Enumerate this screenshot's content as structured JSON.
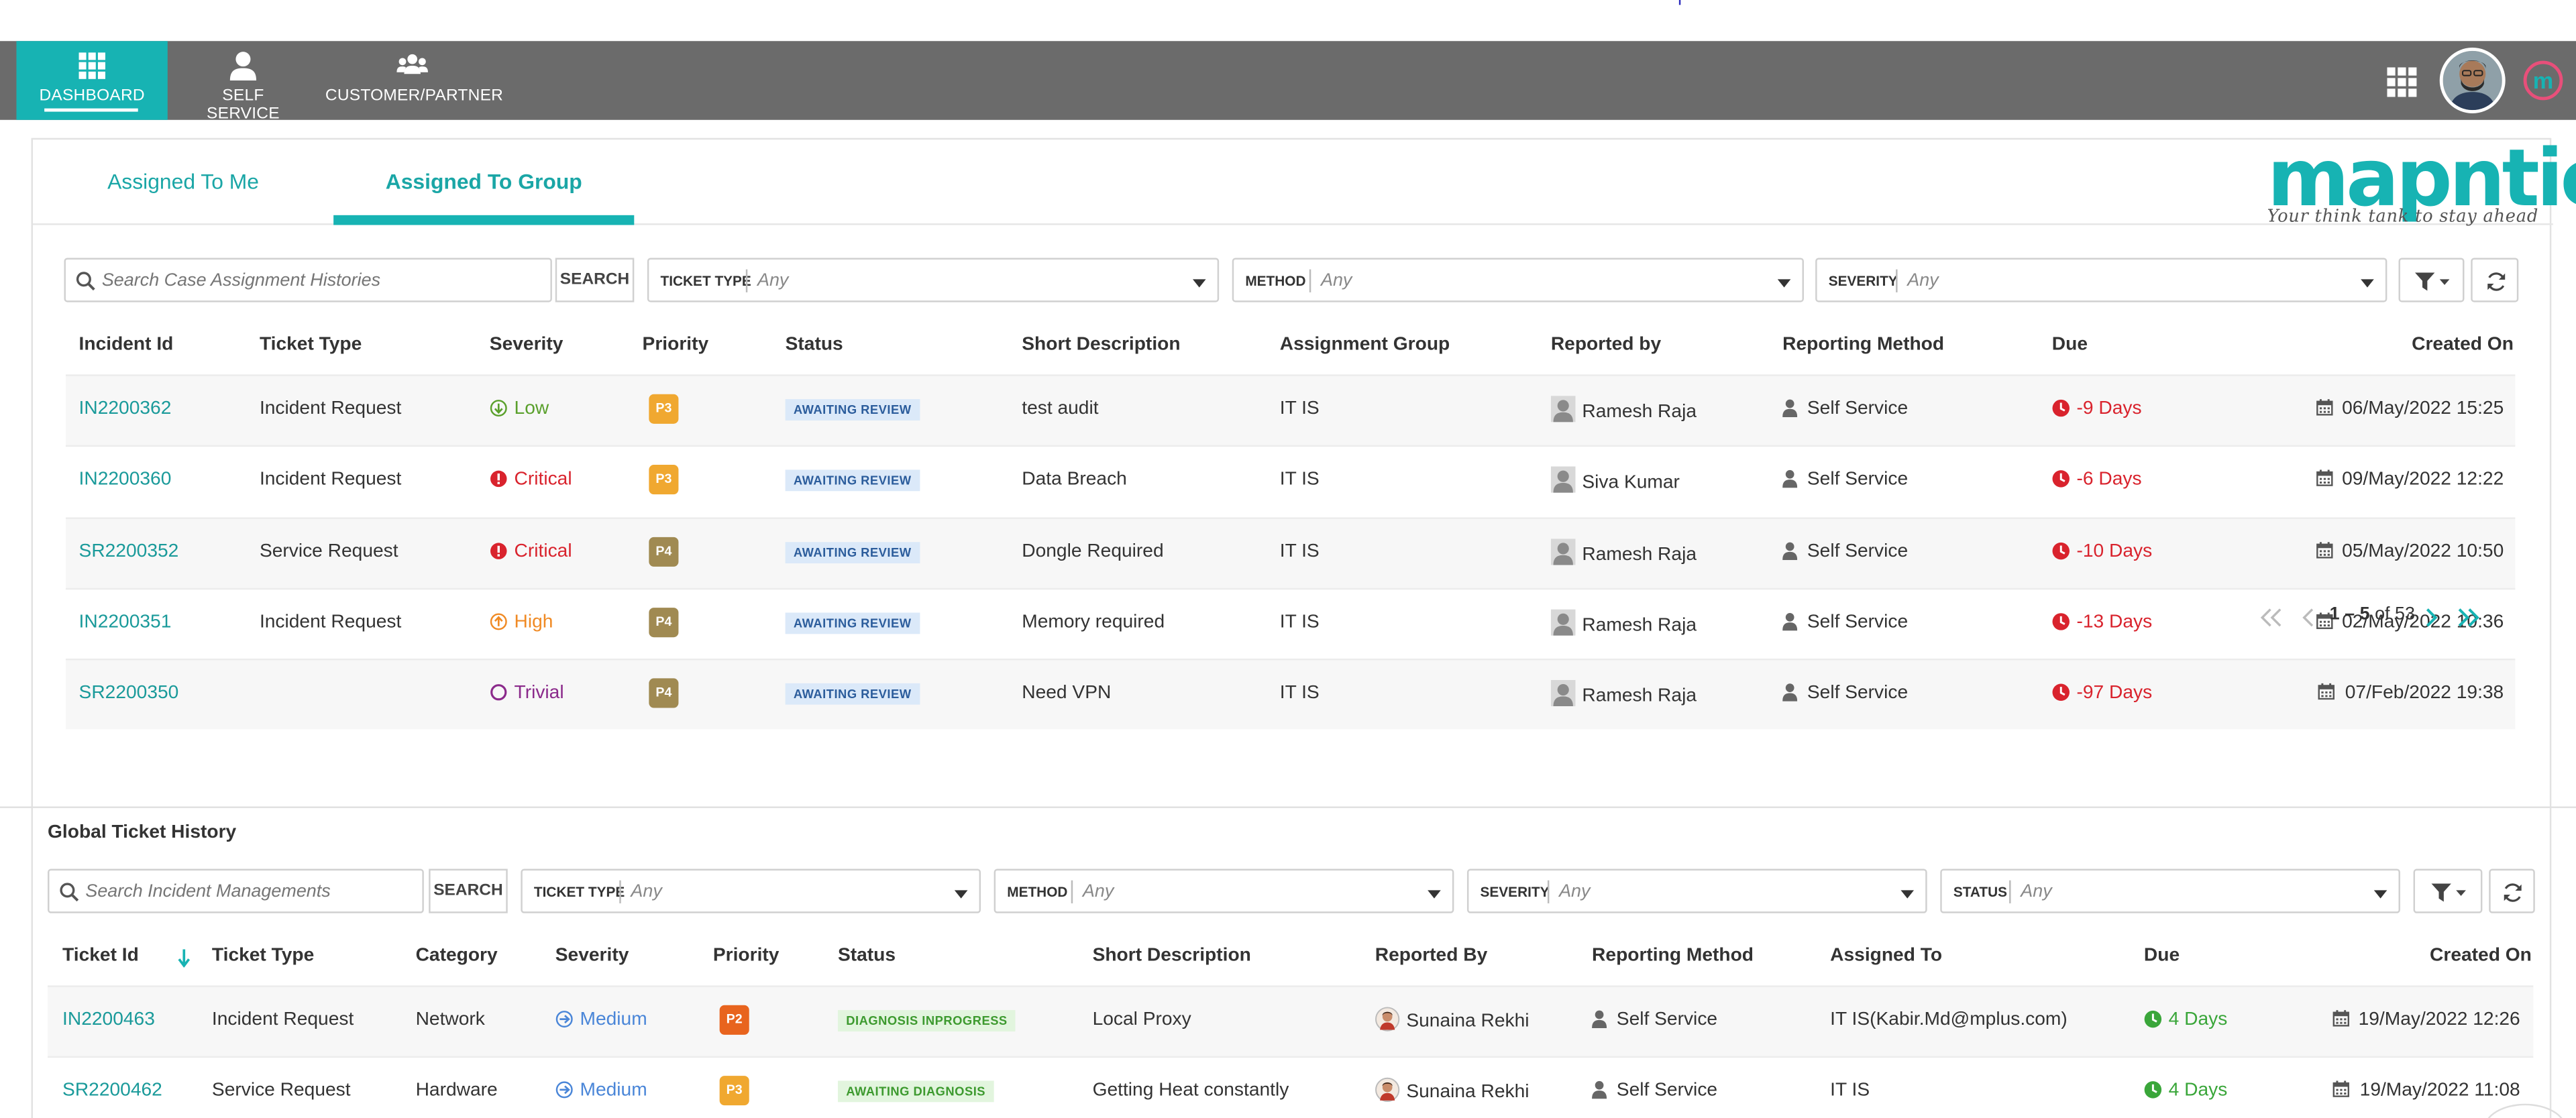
{
  "nav": {
    "items": [
      {
        "label": "DASHBOARD"
      },
      {
        "label": "SELF SERVICE"
      },
      {
        "label": "CUSTOMER/PARTNER"
      }
    ]
  },
  "tabs": [
    {
      "label": "Assigned To Me"
    },
    {
      "label": "Assigned To Group"
    }
  ],
  "brand": {
    "logo_text": "mapntic",
    "tagline": "Your think tank to stay ahead",
    "accent": "#17b3b3"
  },
  "group_filters": {
    "search_placeholder": "Search Case Assignment Histories",
    "search_label": "SEARCH",
    "ticket_type_label": "TICKET TYPE",
    "ticket_type_value": "Any",
    "method_label": "METHOD",
    "method_value": "Any",
    "severity_label": "SEVERITY",
    "severity_value": "Any"
  },
  "group_table": {
    "headers": [
      "Incident Id",
      "Ticket Type",
      "Severity",
      "Priority",
      "Status",
      "Short Description",
      "Assignment Group",
      "Reported by",
      "Reporting Method",
      "Due",
      "Created On"
    ],
    "rows": [
      {
        "id": "IN2200362",
        "type": "Incident Request",
        "severity": "Low",
        "sev_color": "#5aa02c",
        "priority": "P3",
        "prio_color": "#f0a830",
        "status": "AWAITING REVIEW",
        "desc": "test audit",
        "group": "IT IS",
        "reporter": "Ramesh Raja",
        "method": "Self Service",
        "due": "-9 Days",
        "created": "06/May/2022 15:25"
      },
      {
        "id": "IN2200360",
        "type": "Incident Request",
        "severity": "Critical",
        "sev_color": "#d9232d",
        "priority": "P3",
        "prio_color": "#f0a830",
        "status": "AWAITING REVIEW",
        "desc": "Data Breach",
        "group": "IT IS",
        "reporter": "Siva Kumar",
        "method": "Self Service",
        "due": "-6 Days",
        "created": "09/May/2022 12:22"
      },
      {
        "id": "SR2200352",
        "type": "Service Request",
        "severity": "Critical",
        "sev_color": "#d9232d",
        "priority": "P4",
        "prio_color": "#a08a52",
        "status": "AWAITING REVIEW",
        "desc": "Dongle Required",
        "group": "IT IS",
        "reporter": "Ramesh Raja",
        "method": "Self Service",
        "due": "-10 Days",
        "created": "05/May/2022 10:50"
      },
      {
        "id": "IN2200351",
        "type": "Incident Request",
        "severity": "High",
        "sev_color": "#f08a24",
        "priority": "P4",
        "prio_color": "#a08a52",
        "status": "AWAITING REVIEW",
        "desc": "Memory required",
        "group": "IT IS",
        "reporter": "Ramesh Raja",
        "method": "Self Service",
        "due": "-13 Days",
        "created": "02/May/2022 10:36"
      },
      {
        "id": "SR2200350",
        "type": "",
        "severity": "Trivial",
        "sev_color": "#8b2a8b",
        "priority": "P4",
        "prio_color": "#a08a52",
        "status": "AWAITING REVIEW",
        "desc": "Need VPN",
        "group": "IT IS",
        "reporter": "Ramesh Raja",
        "method": "Self Service",
        "due": "-97 Days",
        "created": "07/Feb/2022 19:38"
      }
    ]
  },
  "pager": {
    "range": "1 – 5",
    "of_label": "of 53"
  },
  "global": {
    "title": "Global Ticket History",
    "search_placeholder": "Search Incident Managements",
    "search_label": "SEARCH",
    "ticket_type_label": "TICKET TYPE",
    "ticket_type_value": "Any",
    "method_label": "METHOD",
    "method_value": "Any",
    "severity_label": "SEVERITY",
    "severity_value": "Any",
    "status_label": "STATUS",
    "status_value": "Any",
    "headers": [
      "Ticket Id",
      "Ticket Type",
      "Category",
      "Severity",
      "Priority",
      "Status",
      "Short Description",
      "Reported By",
      "Reporting Method",
      "Assigned To",
      "Due",
      "Created On"
    ],
    "rows": [
      {
        "id": "IN2200463",
        "type": "Incident Request",
        "category": "Network",
        "severity": "Medium",
        "priority": "P2",
        "prio_color": "#e8641e",
        "status": "DIAGNOSIS INPROGRESS",
        "desc": "Local Proxy",
        "reporter": "Sunaina Rekhi",
        "method": "Self Service",
        "assigned": "IT IS(Kabir.Md@mplus.com)",
        "due": "4 Days",
        "created": "19/May/2022 12:26"
      },
      {
        "id": "SR2200462",
        "type": "Service Request",
        "category": "Hardware",
        "severity": "Medium",
        "priority": "P3",
        "prio_color": "#f0a830",
        "status": "AWAITING DIAGNOSIS",
        "desc": "Getting Heat constantly",
        "reporter": "Sunaina Rekhi",
        "method": "Self Service",
        "assigned": "IT IS",
        "due": "4 Days",
        "created": "19/May/2022 11:08"
      }
    ]
  },
  "colors": {
    "nav_bg": "#6b6b6b",
    "teal": "#17b3b3",
    "link": "#1a9a9a",
    "overdue": "#d9232d",
    "ontime": "#3aa63a",
    "review_tag_bg": "#dbe9f9",
    "review_tag_fg": "#2c5d9c",
    "diag_tag_bg": "#e2f5de",
    "diag_tag_fg": "#3d9a2f"
  }
}
